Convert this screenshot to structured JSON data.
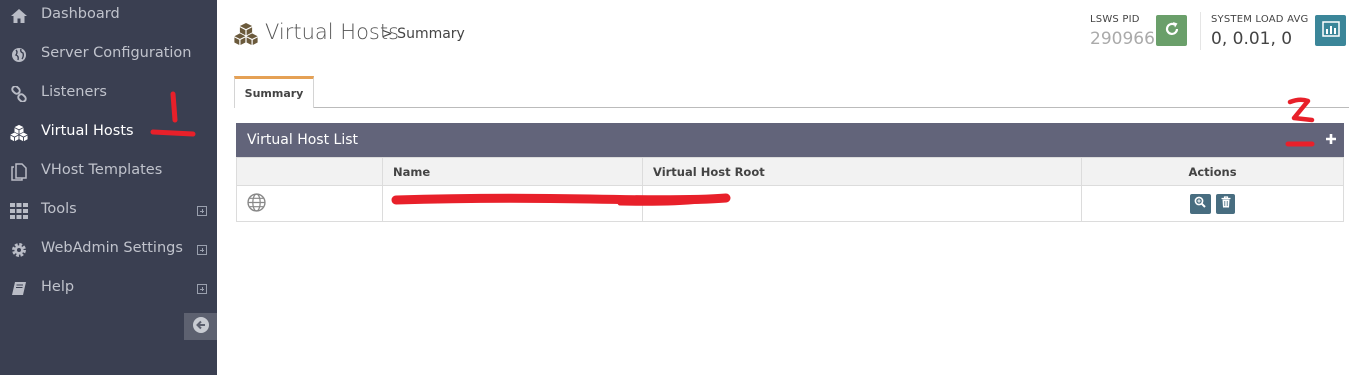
{
  "sidebar": {
    "items": [
      {
        "label": "Dashboard",
        "icon": "home-icon"
      },
      {
        "label": "Server Configuration",
        "icon": "globe-icon"
      },
      {
        "label": "Listeners",
        "icon": "link-icon"
      },
      {
        "label": "Virtual Hosts",
        "icon": "cubes-icon",
        "active": true
      },
      {
        "label": "VHost Templates",
        "icon": "copy-icon"
      },
      {
        "label": "Tools",
        "icon": "grid-icon",
        "expandable": true
      },
      {
        "label": "WebAdmin Settings",
        "icon": "gear-icon",
        "expandable": true
      },
      {
        "label": "Help",
        "icon": "book-icon",
        "expandable": true
      }
    ]
  },
  "header": {
    "title": "Virtual Hosts",
    "breadcrumb": "> Summary",
    "lsws_pid_label": "LSWS PID",
    "lsws_pid_value": "290966",
    "load_label": "SYSTEM LOAD AVG",
    "load_value": "0, 0.01, 0"
  },
  "tabs": [
    {
      "label": "Summary",
      "active": true
    }
  ],
  "panel": {
    "title": "Virtual Host List",
    "columns": [
      "",
      "Name",
      "Virtual Host Root",
      "Actions"
    ],
    "rows": [
      {
        "icon": "globe-icon",
        "name": "",
        "root": "",
        "actions": [
          "view-icon",
          "trash-icon"
        ]
      }
    ]
  },
  "annotations": [
    "1",
    "2"
  ],
  "colors": {
    "sidebar_bg": "#3a3f51",
    "panel_header": "#62647a",
    "tab_accent": "#e5a155",
    "restart_green": "#6a9f6a",
    "stats_teal": "#3b8699",
    "action_btn": "#486d80",
    "annotation_red": "#e8202a"
  }
}
